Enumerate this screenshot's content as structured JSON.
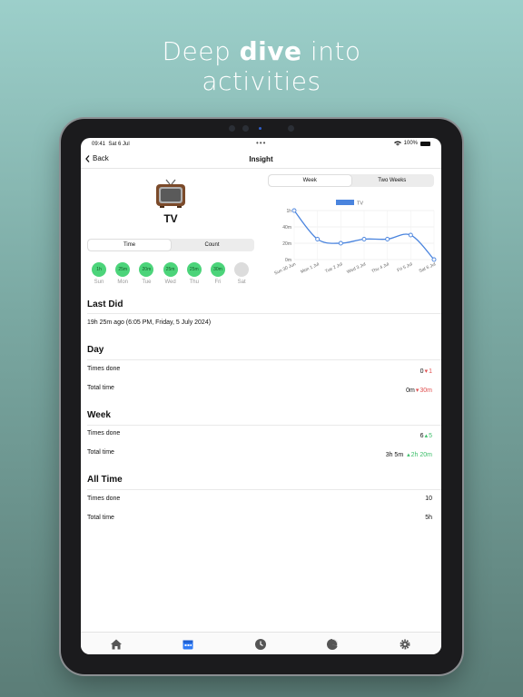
{
  "hero": {
    "line1_prefix": "Deep ",
    "line1_bold": "dive",
    "line1_suffix": " into",
    "line2": "activities"
  },
  "status": {
    "time": "09:41",
    "date": "Sat 6 Jul",
    "battery": "100%"
  },
  "nav": {
    "back_label": "Back",
    "title": "Insight"
  },
  "activity": {
    "name": "TV",
    "emoji": "tv-emoji"
  },
  "left_segment": {
    "options": [
      "Time",
      "Count"
    ],
    "selected": "Time"
  },
  "days": [
    {
      "value": "1h",
      "label": "Sun"
    },
    {
      "value": "25m",
      "label": "Mon"
    },
    {
      "value": "20m",
      "label": "Tue"
    },
    {
      "value": "25m",
      "label": "Wed"
    },
    {
      "value": "25m",
      "label": "Thu"
    },
    {
      "value": "30m",
      "label": "Fri"
    },
    {
      "value": "",
      "label": "Sat"
    }
  ],
  "chart_segment": {
    "options": [
      "Week",
      "Two Weeks"
    ],
    "selected": "Week"
  },
  "chart_data": {
    "type": "line",
    "categories": [
      "Sun 30 Jun",
      "Mon 1 Jul",
      "Tue 2 Jul",
      "Wed 3 Jul",
      "Thu 4 Jul",
      "Fri 5 Jul",
      "Sat 6 Jul"
    ],
    "series": [
      {
        "name": "TV",
        "values": [
          60,
          25,
          20,
          25,
          25,
          30,
          0
        ],
        "color": "#4a84de"
      }
    ],
    "y_ticks": [
      "0m",
      "20m",
      "40m",
      "1h"
    ],
    "ylim": [
      0,
      60
    ],
    "legend": "top-center",
    "grid": true
  },
  "last_did": {
    "title": "Last Did",
    "text": "19h 25m ago (6:05 PM, Friday, 5 July 2024)"
  },
  "day": {
    "title": "Day",
    "rows": [
      {
        "label": "Times done",
        "value": "0",
        "delta": "1",
        "dir": "down"
      },
      {
        "label": "Total time",
        "value": "0m",
        "delta": "30m",
        "dir": "down"
      }
    ]
  },
  "week": {
    "title": "Week",
    "rows": [
      {
        "label": "Times done",
        "value": "6",
        "delta": "5",
        "dir": "up"
      },
      {
        "label": "Total time",
        "value": "3h 5m",
        "delta": "2h 20m",
        "dir": "up"
      }
    ]
  },
  "all_time": {
    "title": "All Time",
    "rows": [
      {
        "label": "Times done",
        "value": "10"
      },
      {
        "label": "Total time",
        "value": "5h"
      }
    ]
  },
  "tabs": [
    {
      "icon": "house-icon",
      "active": false
    },
    {
      "icon": "calendar-icon",
      "active": true
    },
    {
      "icon": "clock-icon",
      "active": false
    },
    {
      "icon": "pie-chart-icon",
      "active": false
    },
    {
      "icon": "gear-icon",
      "active": false
    }
  ],
  "colors": {
    "accent": "#2f7bf6",
    "up": "#3cbf6a",
    "down": "#e05050",
    "day_dot": "#4cd47a"
  }
}
